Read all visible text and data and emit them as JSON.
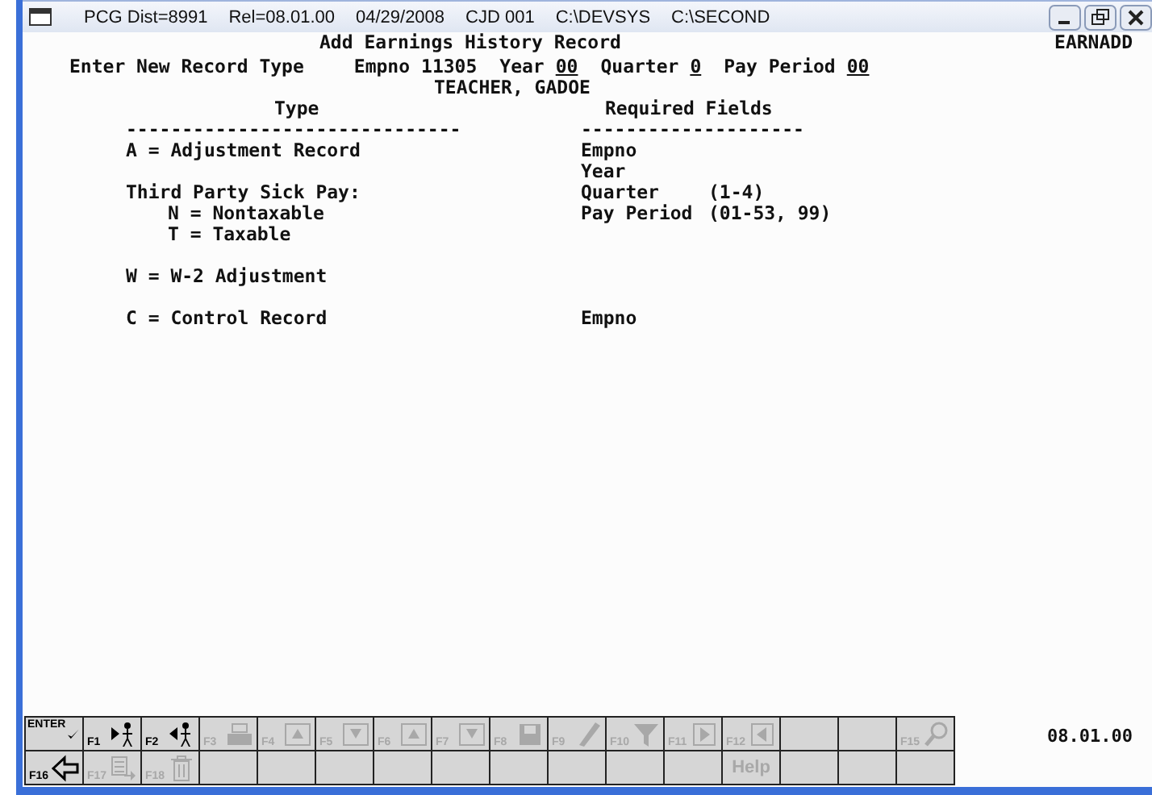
{
  "title_bar": {
    "items": [
      "PCG Dist=8991",
      "Rel=08.01.00",
      "04/29/2008",
      "CJD 001",
      "C:\\DEVSYS",
      "C:\\SECOND"
    ]
  },
  "screen": {
    "title": "Add Earnings History Record",
    "code": "EARNADD"
  },
  "prompt": {
    "label": "Enter New Record Type",
    "fields": [
      {
        "name": "Empno",
        "value": "11305",
        "underline": false
      },
      {
        "name": "Year",
        "value": "00",
        "underline": true
      },
      {
        "name": "Quarter",
        "value": "0",
        "underline": true
      },
      {
        "name": "Pay Period",
        "value": "00",
        "underline": true
      }
    ]
  },
  "employee_name": "TEACHER, GADOE",
  "headers": {
    "type": "Type",
    "required": "Required Fields",
    "type_rule": "------------------------------",
    "required_rule": "--------------------"
  },
  "groups": [
    {
      "types": [
        {
          "label": "A = Adjustment Record"
        },
        {
          "label": "Third Party Sick Pay:",
          "children": [
            {
              "label": "N = Nontaxable"
            },
            {
              "label": "T = Taxable"
            }
          ]
        }
      ],
      "required": [
        {
          "field": "Empno"
        },
        {
          "field": "Year"
        },
        {
          "field": "Quarter",
          "range": "(1-4)"
        },
        {
          "field": "Pay Period",
          "range": "(01-53, 99)"
        }
      ]
    },
    {
      "types": [
        {
          "label": "W = W-2 Adjustment"
        }
      ]
    },
    {
      "types": [
        {
          "label": "C = Control Record"
        }
      ],
      "required": [
        {
          "field": "Empno"
        }
      ]
    }
  ],
  "fkeys": [
    [
      {
        "kind": "enter",
        "key": "ENTER",
        "disabled": false
      },
      {
        "kind": "key",
        "key": "F1",
        "disabled": false
      },
      {
        "kind": "key",
        "key": "F2",
        "disabled": false
      },
      {
        "kind": "key",
        "key": "F3",
        "disabled": true
      },
      {
        "kind": "key",
        "key": "F4",
        "disabled": true
      },
      {
        "kind": "key",
        "key": "F5",
        "disabled": true
      },
      {
        "kind": "key",
        "key": "F6",
        "disabled": true
      },
      {
        "kind": "key",
        "key": "F7",
        "disabled": true
      },
      {
        "kind": "key",
        "key": "F8",
        "disabled": true
      },
      {
        "kind": "key",
        "key": "F9",
        "disabled": true
      },
      {
        "kind": "key",
        "key": "F10",
        "disabled": true
      },
      {
        "kind": "key",
        "key": "F11",
        "disabled": true
      },
      {
        "kind": "key",
        "key": "F12",
        "disabled": true
      },
      {
        "kind": "blank"
      },
      {
        "kind": "blank"
      },
      {
        "kind": "key",
        "key": "F15",
        "disabled": true
      }
    ],
    [
      {
        "kind": "key",
        "key": "F16",
        "disabled": false
      },
      {
        "kind": "key",
        "key": "F17",
        "disabled": true
      },
      {
        "kind": "key",
        "key": "F18",
        "disabled": true
      },
      {
        "kind": "blank"
      },
      {
        "kind": "blank"
      },
      {
        "kind": "blank"
      },
      {
        "kind": "blank"
      },
      {
        "kind": "blank"
      },
      {
        "kind": "blank"
      },
      {
        "kind": "blank"
      },
      {
        "kind": "blank"
      },
      {
        "kind": "blank"
      },
      {
        "kind": "text",
        "text": "Help",
        "disabled": true
      },
      {
        "kind": "blank"
      },
      {
        "kind": "blank"
      },
      {
        "kind": "blank"
      }
    ]
  ],
  "version": "08.01.00"
}
